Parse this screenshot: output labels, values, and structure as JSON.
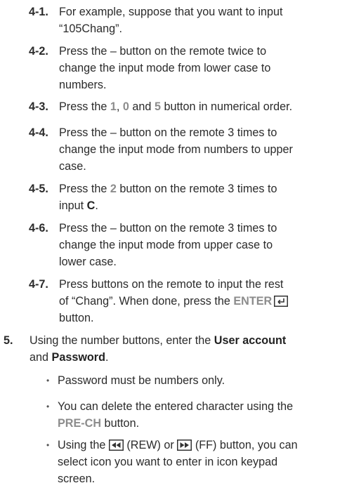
{
  "sub_steps": [
    {
      "num": "4-1.",
      "lines": [
        "For example, suppose that you want to input",
        "“105Chang”."
      ]
    },
    {
      "num": "4-2.",
      "lines": [
        "Press the – button on the remote twice to",
        "change the input mode from lower case to",
        "numbers."
      ]
    },
    {
      "num": "4-3.",
      "pre": "Press the ",
      "k1": "1",
      "s1": ", ",
      "k2": "0",
      "s2": " and ",
      "k3": "5",
      "post": " button in numerical order."
    },
    {
      "num": "4-4.",
      "lines": [
        "Press the – button on the remote 3 times to",
        "change the input mode from numbers to upper",
        "case."
      ]
    },
    {
      "num": "4-5.",
      "pre": "Press the ",
      "k1": "2",
      "post": " button on the remote 3 times to",
      "line2_pre": "input ",
      "line2_bold": "C",
      "line2_post": "."
    },
    {
      "num": "4-6.",
      "lines": [
        "Press the – button on the remote 3 times to",
        "change the input mode from upper case to",
        "lower case."
      ]
    },
    {
      "num": "4-7.",
      "line1": "Press buttons on the remote to input the rest",
      "line2_pre": "of “Chang”. When done, press the ",
      "enter_label": "ENTER",
      "line3": "button."
    }
  ],
  "step5": {
    "num": "5.",
    "line1_pre": "Using the number buttons, enter the ",
    "line1_bold": "User account",
    "line2_pre": "and ",
    "line2_bold": "Password",
    "line2_post": "."
  },
  "bullets": [
    {
      "dot": "•",
      "text": "Password must be numbers only."
    },
    {
      "dot": "•",
      "line1": "You can delete the entered character using the",
      "key": "PRE-CH",
      "line2_post": " button."
    },
    {
      "dot": "•",
      "pre": "Using the ",
      "mid1": " (REW) or ",
      "post1": " (FF) button, you can",
      "line2": "select icon you want to enter in icon keypad",
      "line3": "screen.",
      "icon_rew": "rewind-icon",
      "icon_ff": "fast-forward-icon"
    }
  ]
}
